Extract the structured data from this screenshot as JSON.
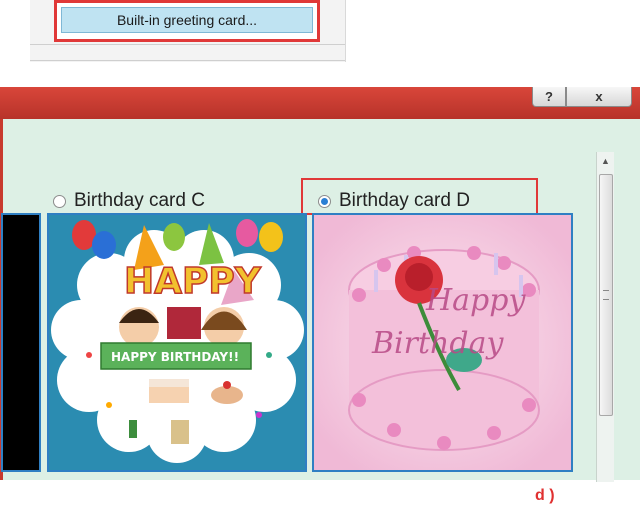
{
  "menu": {
    "builtin_label": "Built-in greeting card..."
  },
  "dialog": {
    "help_glyph": "?",
    "close_glyph": "x"
  },
  "options": {
    "card_c_label": "Birthday card C",
    "card_d_label": "Birthday card D",
    "selected": "Birthday card D"
  },
  "card_c": {
    "headline": "HAPPY",
    "banner_text": "HAPPY BIRTHDAY!!"
  },
  "card_d": {
    "line1": "Happy",
    "line2": "Birthday"
  },
  "step_label": "d )",
  "colors": {
    "highlight_red": "#e03838",
    "card_border_blue": "#2f7fc3",
    "dialog_client": "#ddf0e5"
  }
}
